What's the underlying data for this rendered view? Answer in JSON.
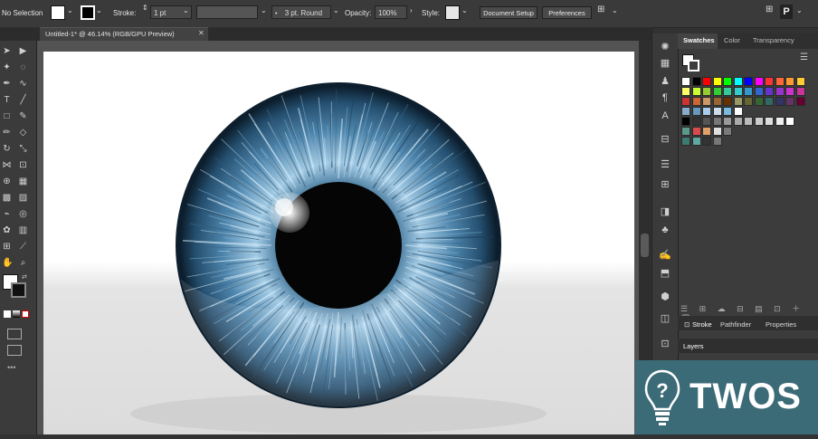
{
  "control_bar": {
    "selection_label": "No Selection",
    "stroke_label": "Stroke:",
    "stroke_weight": "1 pt",
    "brush_label": "3 pt. Round",
    "opacity_label": "Opacity:",
    "opacity_value": "100%",
    "style_label": "Style:",
    "document_setup_label": "Document Setup",
    "preferences_label": "Preferences"
  },
  "document_tab": {
    "title": "Untitled-1* @ 46.14% (RGB/GPU Preview)",
    "close_glyph": "✕"
  },
  "panels": {
    "swatches_tab": "Swatches",
    "color_tab": "Color",
    "transparency_tab": "Transparency",
    "stroke_tab": "Stroke",
    "pathfinder_tab": "Pathfinder",
    "properties_tab": "Properties",
    "layers_tab": "Layers"
  },
  "watermark": {
    "text": "TWOS"
  },
  "colors": {
    "iris_light": "#a8cfe8",
    "iris_mid": "#4f86ad",
    "iris_dark": "#16324a",
    "accent_watermark": "#3c6b78"
  },
  "icons": [
    "selection-tool-icon",
    "direct-selection-icon",
    "pen-tool-icon",
    "type-tool-icon",
    "brush-icon",
    "eraser-icon",
    "zoom-icon",
    "hand-icon",
    "swatches-icon",
    "layers-icon",
    "symbols-icon",
    "brushes-icon"
  ]
}
